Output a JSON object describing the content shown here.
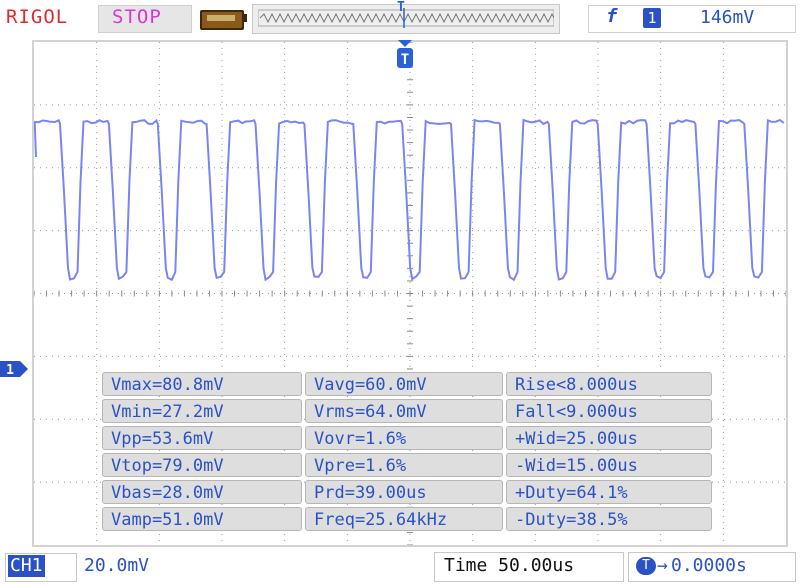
{
  "header": {
    "brand": "RIGOL",
    "run_state": "STOP",
    "memory_marker": "T",
    "trigger": {
      "edge_symbol": "f",
      "channel": "1",
      "level": "146mV"
    }
  },
  "screen": {
    "trigger_position_marker": "T",
    "channel_marker": "1"
  },
  "measurements": {
    "rows": [
      [
        "Vmax=80.8mV",
        "Vavg=60.0mV",
        "Rise<8.000us"
      ],
      [
        "Vmin=27.2mV",
        "Vrms=64.0mV",
        "Fall<9.000us"
      ],
      [
        "Vpp=53.6mV",
        "Vovr=1.6%",
        "+Wid=25.00us"
      ],
      [
        "Vtop=79.0mV",
        "Vpre=1.6%",
        "-Wid=15.00us"
      ],
      [
        "Vbas=28.0mV",
        "Prd=39.00us",
        "+Duty=64.1%"
      ],
      [
        "Vamp=51.0mV",
        "Freq=25.64kHz",
        "-Duty=38.5%"
      ]
    ]
  },
  "footer": {
    "channel_label": "CH1",
    "channel_scale": "20.0mV",
    "timebase": "Time 50.00us",
    "offset_icon": "T",
    "offset_arrow": "→",
    "offset_value": "0.0000s"
  },
  "colors": {
    "brand": "#e0282e",
    "stop": "#e033d6",
    "accent": "#2a52c6",
    "trace": "#7a86f0",
    "grid": "#9a9a9a"
  },
  "icons": {
    "battery": "battery-icon",
    "edge": "rising-edge-icon",
    "trigger_marker": "trigger-position-icon",
    "channel_marker": "channel-1-marker-icon"
  }
}
